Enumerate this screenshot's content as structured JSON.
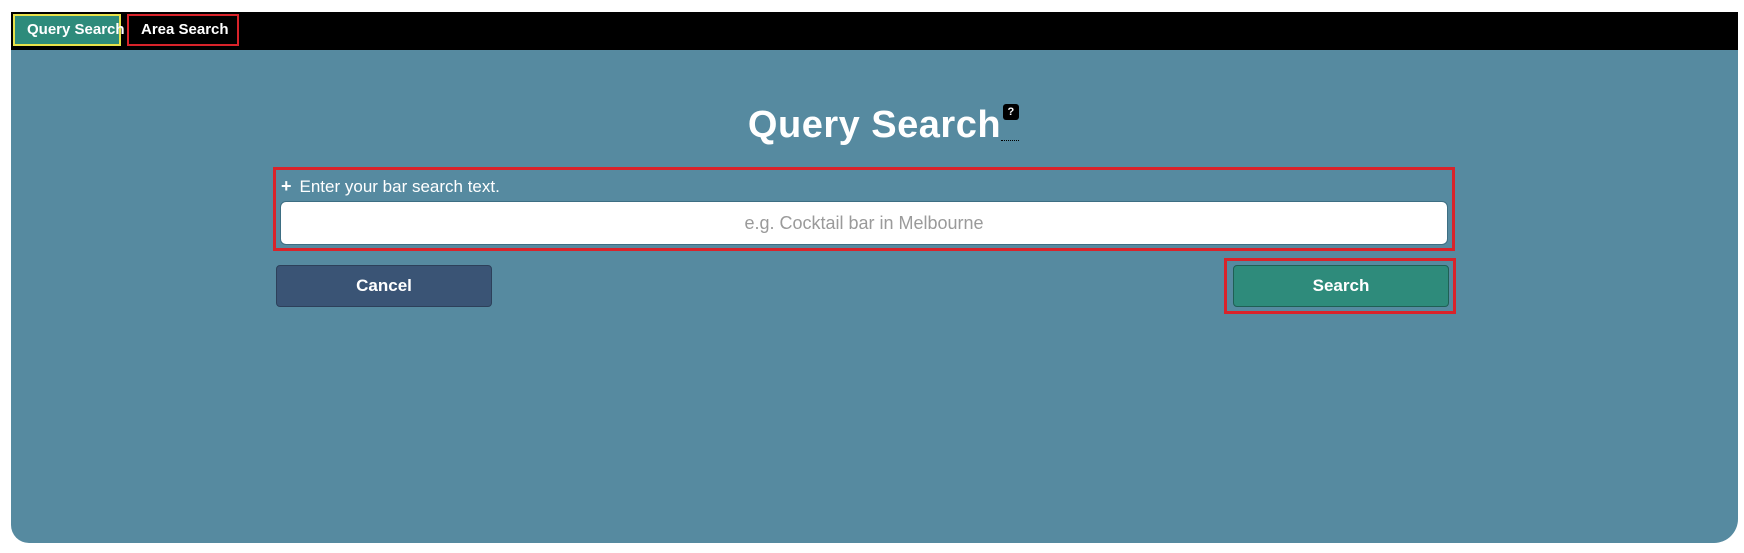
{
  "tabs": [
    {
      "label": "Query Search",
      "active": true
    },
    {
      "label": "Area Search",
      "active": false
    }
  ],
  "main": {
    "title": "Query Search",
    "help_icon": "?",
    "search_label": "Enter your bar search text.",
    "search_placeholder": "e.g. Cocktail bar in Melbourne",
    "search_value": ""
  },
  "buttons": {
    "cancel_label": "Cancel",
    "search_label": "Search"
  },
  "colors": {
    "panel_bg": "#568aa0",
    "tabbar_bg": "#000000",
    "active_tab": "#2e8b7b",
    "cancel_button": "#3a5475",
    "search_button": "#2e8b7b",
    "highlight_red": "#d9232a",
    "highlight_yellow": "#e8e24a"
  },
  "icons": {
    "plus": "plus-icon",
    "help": "help-icon"
  }
}
